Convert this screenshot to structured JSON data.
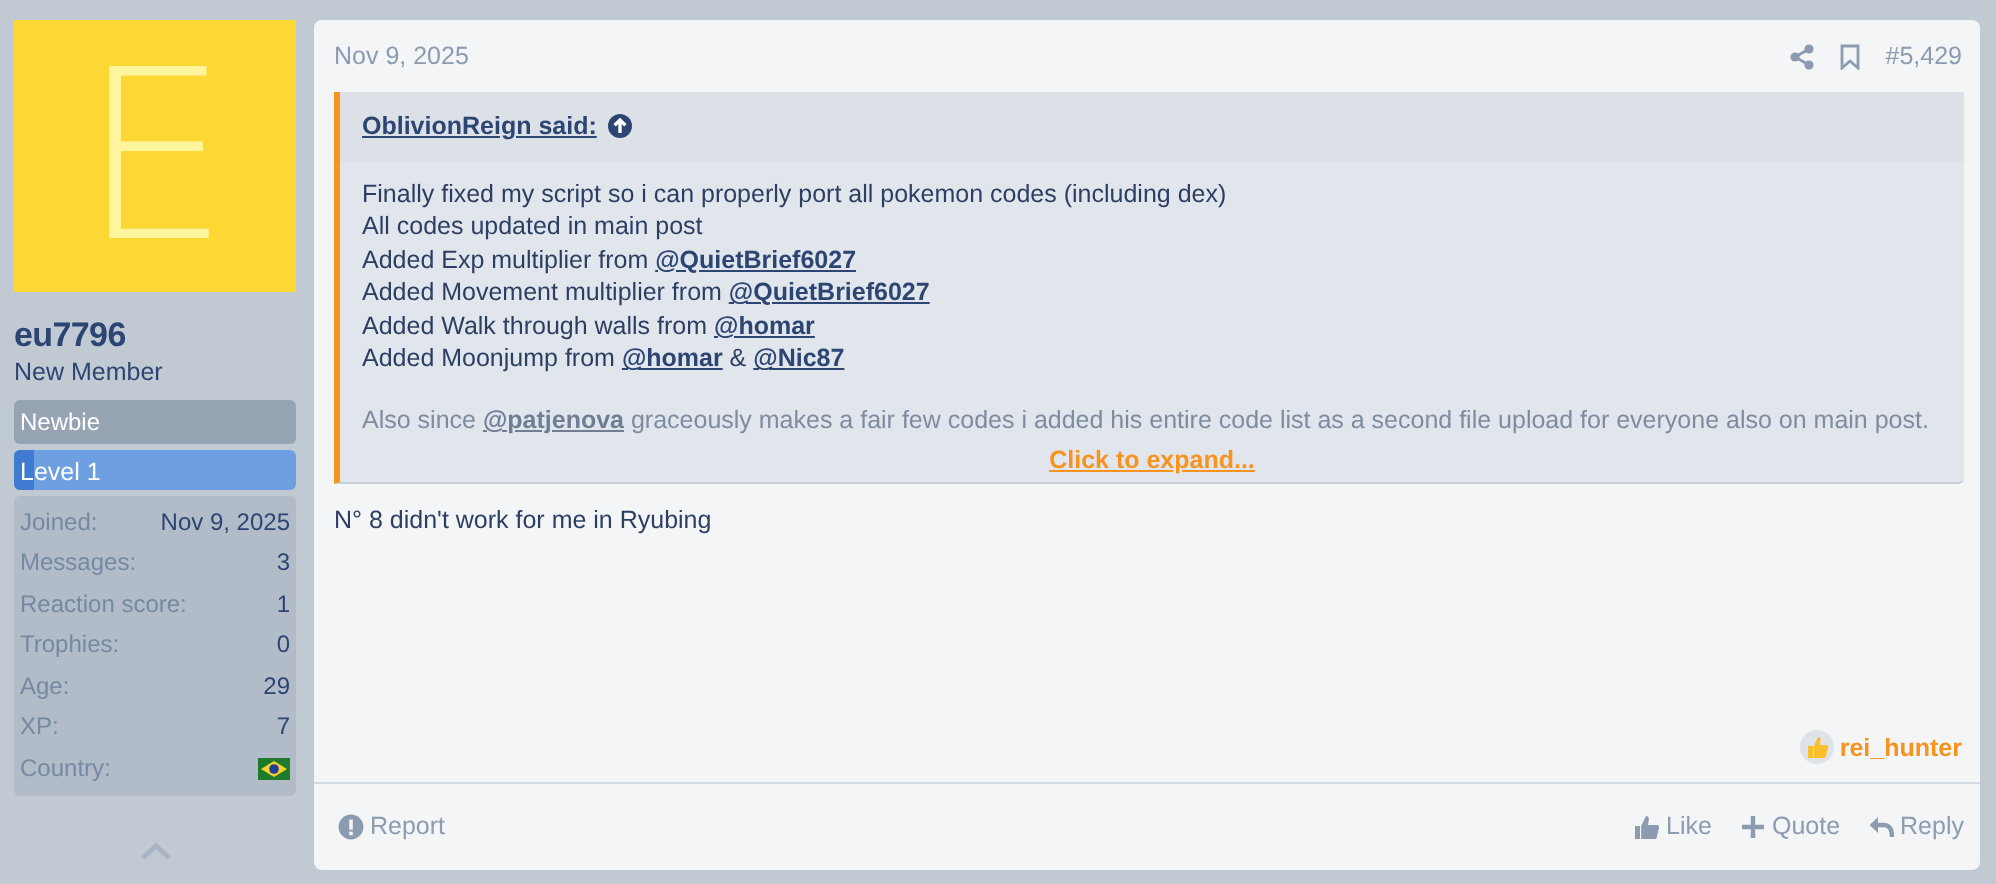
{
  "user": {
    "avatar_letter": "E",
    "name": "eu7796",
    "title": "New Member",
    "banner": "Newbie",
    "level": {
      "label": "Level 1",
      "level": 0.07
    },
    "stats": [
      {
        "label": "Joined:",
        "value": "Nov 9, 2025"
      },
      {
        "label": "Messages:",
        "value": "3"
      },
      {
        "label": "Reaction score:",
        "value": "1"
      },
      {
        "label": "Trophies:",
        "value": "0"
      },
      {
        "label": "Age:",
        "value": "29"
      },
      {
        "label": "XP:",
        "value": "7"
      },
      {
        "label": "Country:",
        "kind": "flag"
      }
    ]
  },
  "post": {
    "date": "Nov 9, 2025",
    "number": "#5,429",
    "quote": {
      "author": "OblivionReign said:",
      "lines": [
        [
          {
            "text": "Finally fixed my script so i can properly port all pokemon codes (including dex)"
          }
        ],
        [
          {
            "text": "All codes updated in main post"
          }
        ],
        [
          {
            "text": "Added Exp multiplier from "
          },
          {
            "text": "@QuietBrief6027",
            "mention": true
          }
        ],
        [
          {
            "text": "Added Movement multiplier from "
          },
          {
            "text": "@QuietBrief6027",
            "mention": true
          }
        ],
        [
          {
            "text": "Added Walk through walls from "
          },
          {
            "text": "@homar",
            "mention": true
          }
        ],
        [
          {
            "text": "Added Moonjump from "
          },
          {
            "text": "@homar",
            "mention": true
          },
          {
            "text": " & "
          },
          {
            "text": "@Nic87",
            "mention": true
          }
        ]
      ],
      "faded": [
        {
          "text": "Also since "
        },
        {
          "text": "@patjenova",
          "mention": true
        },
        {
          "text": " graceously makes a fair few codes i added his entire code list as a second file upload for everyone also on main post."
        }
      ],
      "expand": "Click to expand..."
    },
    "body": "N° 8 didn't work for me in Ryubing",
    "reactions": [
      {
        "user": "rei_hunter"
      }
    ],
    "actions_left": [
      {
        "label": "Report",
        "kind": "report"
      }
    ],
    "actions_right": [
      {
        "label": "Like",
        "kind": "like"
      },
      {
        "label": "Quote",
        "kind": "quote"
      },
      {
        "label": "Reply",
        "kind": "reply"
      }
    ]
  }
}
